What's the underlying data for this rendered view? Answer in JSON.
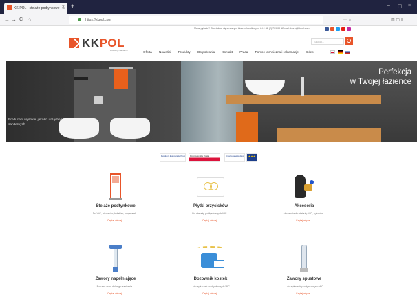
{
  "browser": {
    "tab_title": "KK-POL - stelaże podtynkowe i ...",
    "tab_close": "×",
    "new_tab": "+",
    "url": "https://kkpol.com",
    "controls": [
      "–",
      "▢",
      "×"
    ],
    "nav": {
      "back": "←",
      "forward": "→",
      "reload": "C",
      "home": "⌂"
    },
    "toolbar_icons": "··· ☆",
    "toolbar_right": "▥ ▢ ≡"
  },
  "site": {
    "topline_text": "Masz pytania? Skontaktuj się z naszym biurem handlowym: tel. +48 (2) 709 00 12 mail: biuro@kkpol.com",
    "social_colors": [
      "#3b5998",
      "#e8552a",
      "#1da1f2",
      "#e62117",
      "#c32aa3"
    ],
    "logo_kk": "KK",
    "logo_pol": "POL",
    "logo_sub": "instalacje sanitarne",
    "search_placeholder": "Szukaj...",
    "menu": [
      "Oferta",
      "Nowości",
      "Produkty",
      "Do pobrania",
      "Kontakt",
      "Praca",
      "Pomoc techniczna i reklamacje",
      "Sklep"
    ],
    "flag_colors": [
      [
        "#fff",
        "#dc143c"
      ],
      [
        "#000",
        "#dd0000"
      ],
      [
        "#fff",
        "#d52b1e"
      ]
    ]
  },
  "hero": {
    "title_line1": "Perfekcja",
    "title_line2": "w Twojej łazience",
    "tagline": "Producent wysokiej jakości urządzeń sanitarnych"
  },
  "eu_logos": [
    "Fundusze Europejskie Program Regionalny",
    "Rzeczpospolita Polska",
    "Unia Europejska Europejski Fundusz Rozwoju Regionalnego",
    "★★★"
  ],
  "products": [
    {
      "title": "Stelaże podtynkowe",
      "desc": "Do WC, pisuarów, bidetów, umywalek...",
      "more": "Czytaj więcej..."
    },
    {
      "title": "Płytki przycisków",
      "desc": "Do stelaży podtynkowych WC...",
      "more": "Czytaj więcej..."
    },
    {
      "title": "Akcesoria",
      "desc": "Akcesoria do stelaży WC, syfonów...",
      "more": "Czytaj więcej..."
    },
    {
      "title": "Zawory napełniające",
      "desc": "Boczne oraz dolnego zasilania...",
      "more": "Czytaj więcej..."
    },
    {
      "title": "Dozownik kostek",
      "desc": "...do spłuczek podtynkowych WC",
      "more": "Czytaj więcej..."
    },
    {
      "title": "Zawory spustowe",
      "desc": "...do spłuczek podtynkowych WC",
      "more": "Czytaj więcej..."
    }
  ],
  "colors": {
    "brand": "#e8552a",
    "dark": "#202340"
  }
}
